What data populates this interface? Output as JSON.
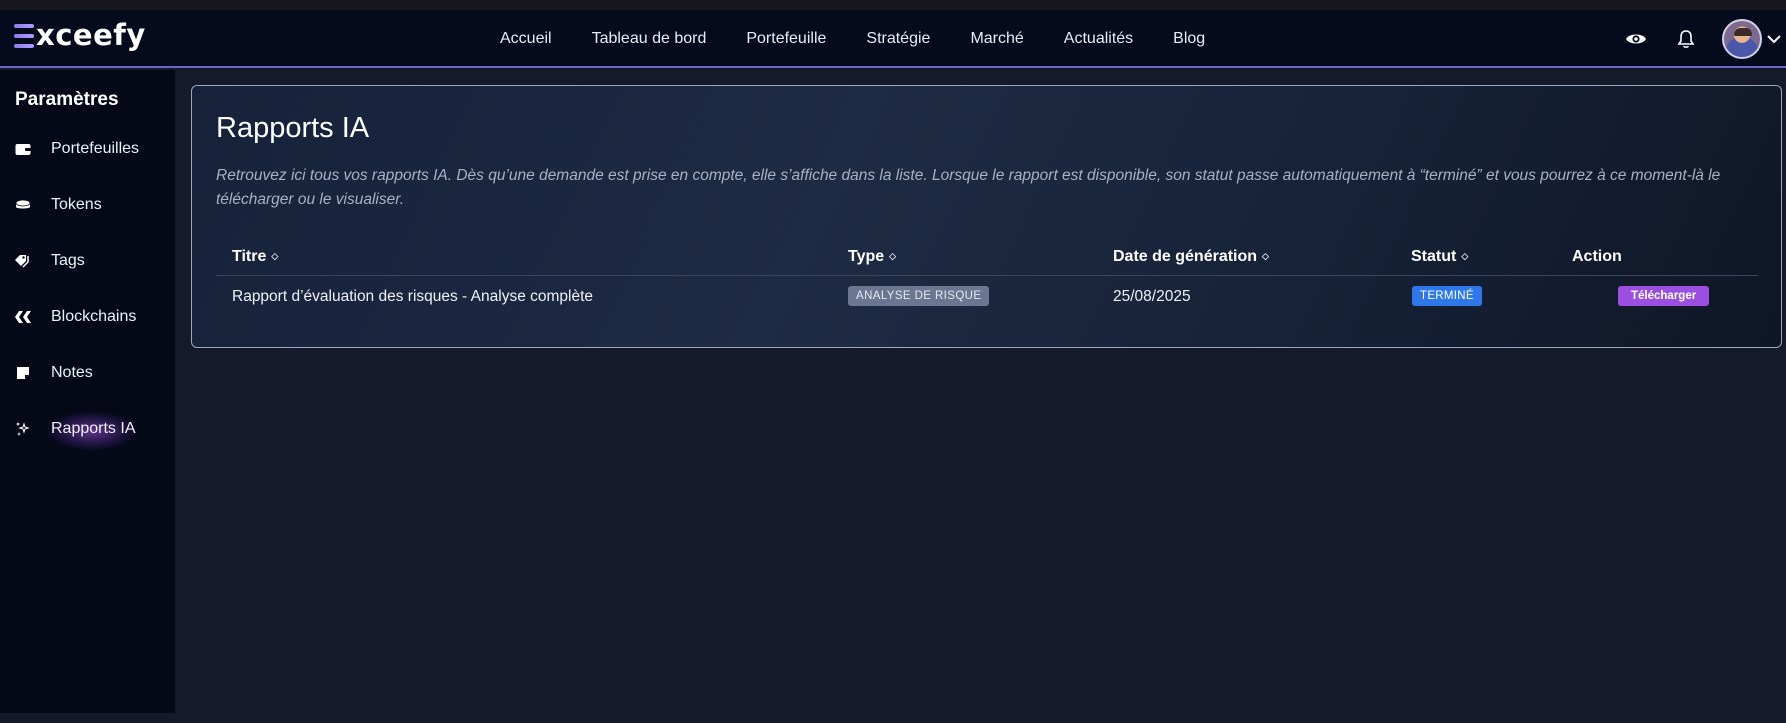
{
  "app": {
    "logo_text": "xceefy"
  },
  "nav": {
    "items": [
      {
        "label": "Accueil"
      },
      {
        "label": "Tableau de bord"
      },
      {
        "label": "Portefeuille"
      },
      {
        "label": "Stratégie"
      },
      {
        "label": "Marché"
      },
      {
        "label": "Actualités"
      },
      {
        "label": "Blog"
      }
    ],
    "right_icons": [
      "eye-icon",
      "bell-icon",
      "avatar",
      "chevron-down-icon"
    ]
  },
  "sidebar": {
    "title": "Paramètres",
    "items": [
      {
        "label": "Portefeuilles",
        "icon": "wallet-icon"
      },
      {
        "label": "Tokens",
        "icon": "coin-icon"
      },
      {
        "label": "Tags",
        "icon": "tags-icon"
      },
      {
        "label": "Blockchains",
        "icon": "blockchain-icon"
      },
      {
        "label": "Notes",
        "icon": "note-icon"
      },
      {
        "label": "Rapports IA",
        "icon": "sparkle-icon",
        "active": true
      }
    ]
  },
  "main": {
    "title": "Rapports IA",
    "description": "Retrouvez ici tous vos rapports IA. Dès qu’une demande est prise en compte, elle s’affiche dans la liste. Lorsque le rapport est disponible, son statut passe automatiquement à “terminé” et vous pourrez à ce moment-là le télécharger ou le visualiser.",
    "table": {
      "columns": [
        {
          "label": "Titre",
          "sortable": true
        },
        {
          "label": "Type",
          "sortable": true
        },
        {
          "label": "Date de génération",
          "sortable": true
        },
        {
          "label": "Statut",
          "sortable": true
        },
        {
          "label": "Action",
          "sortable": false
        }
      ],
      "rows": [
        {
          "title": "Rapport d’évaluation des risques - Analyse complète",
          "type": "ANALYSE DE RISQUE",
          "date": "25/08/2025",
          "status": "TERMINÉ",
          "action": "Télécharger"
        }
      ]
    }
  },
  "colors": {
    "accent": "#9b4fe0",
    "status_done": "#2f78ea",
    "type_badge": "#6b7790",
    "nav_border": "#6e67c9"
  }
}
